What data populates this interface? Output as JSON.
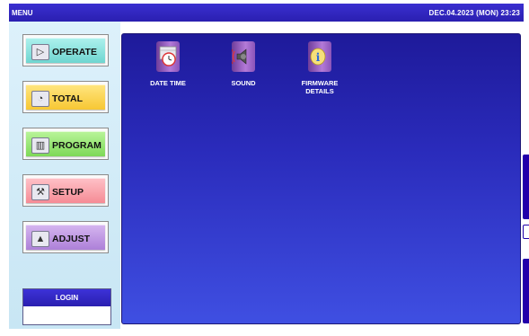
{
  "window": {
    "title": "MENU",
    "datetime": "DEC.04.2023 (MON) 23:23"
  },
  "sidebar": {
    "buttons": [
      {
        "label": "OPERATE",
        "icon": "play-icon",
        "color": "#6fd6d0"
      },
      {
        "label": "TOTAL",
        "icon": "clock-icon",
        "color": "#f7c733"
      },
      {
        "label": "PROGRAM",
        "icon": "book-icon",
        "color": "#7ed957"
      },
      {
        "label": "SETUP",
        "icon": "wrench-icon",
        "color": "#f58b95"
      },
      {
        "label": "ADJUST",
        "icon": "scale-icon",
        "color": "#ad80d8"
      }
    ],
    "login": {
      "label": "LOGIN",
      "value": ""
    }
  },
  "main": {
    "items": [
      {
        "label": "DATE TIME",
        "icon": "calendar-clock-icon"
      },
      {
        "label": "SOUND",
        "icon": "speaker-icon"
      },
      {
        "label": "FIRMWARE\nDETAILS",
        "icon": "info-icon"
      }
    ]
  },
  "colors": {
    "topbar": "#2a1fb0",
    "panel_top": "#1e1a9a",
    "panel_bottom": "#3f4fe2"
  }
}
